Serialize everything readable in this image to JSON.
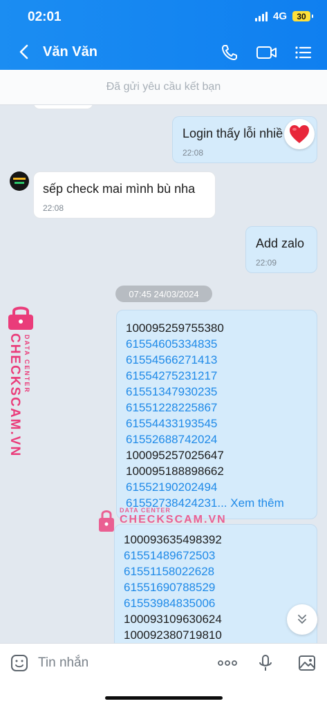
{
  "status_bar": {
    "time": "02:01",
    "network": "4G",
    "battery": "30"
  },
  "header": {
    "contact_name": "Văn Văn"
  },
  "friend_request": {
    "text": "Đã gửi yêu cầu kết bạn"
  },
  "messages": {
    "m1": {
      "text": "Login thấy lỗi nhiề",
      "time": "22:08"
    },
    "m2": {
      "text": "sếp check mai mình bù nha",
      "time": "22:08"
    },
    "m3": {
      "text": "Add zalo",
      "time": "22:09"
    },
    "date_divider": "07:45 24/03/2024",
    "block1": {
      "numbers": [
        "100095259755380",
        "61554605334835",
        "61554566271413",
        "61554275231217",
        "61551347930235",
        "61551228225867",
        "61554433193545",
        "61552688742024",
        "100095257025647",
        "100095188898662",
        "61552190202494",
        "61552738424231..."
      ],
      "see_more": "Xem thêm"
    },
    "block2": {
      "numbers": [
        "100093635498392",
        "61551489672503",
        "61551158022628",
        "61551690788529",
        "61553984835006",
        "100093109630624",
        "100092380719810"
      ]
    }
  },
  "watermark": {
    "left_big": "CHECKSCAM.VN",
    "left_small": "DATA CENTER",
    "mid_small": "DATA CENTER",
    "mid_big": "CHECKSCAM.VN",
    "color": "#ea3c7a"
  },
  "composer": {
    "placeholder": "Tin nhắn"
  },
  "icons": {
    "back": "chevron-left-icon",
    "call": "phone-icon",
    "video": "video-camera-icon",
    "menu": "list-menu-icon",
    "reaction": "heart-icon",
    "scroll": "double-chevron-down-icon",
    "sticker": "smiley-icon",
    "more": "more-dots-icon",
    "voice": "microphone-icon",
    "image": "image-icon"
  },
  "colors": {
    "header": "#1b8df2",
    "link": "#1f8ae8",
    "bubble_out": "#d5ebfb"
  }
}
